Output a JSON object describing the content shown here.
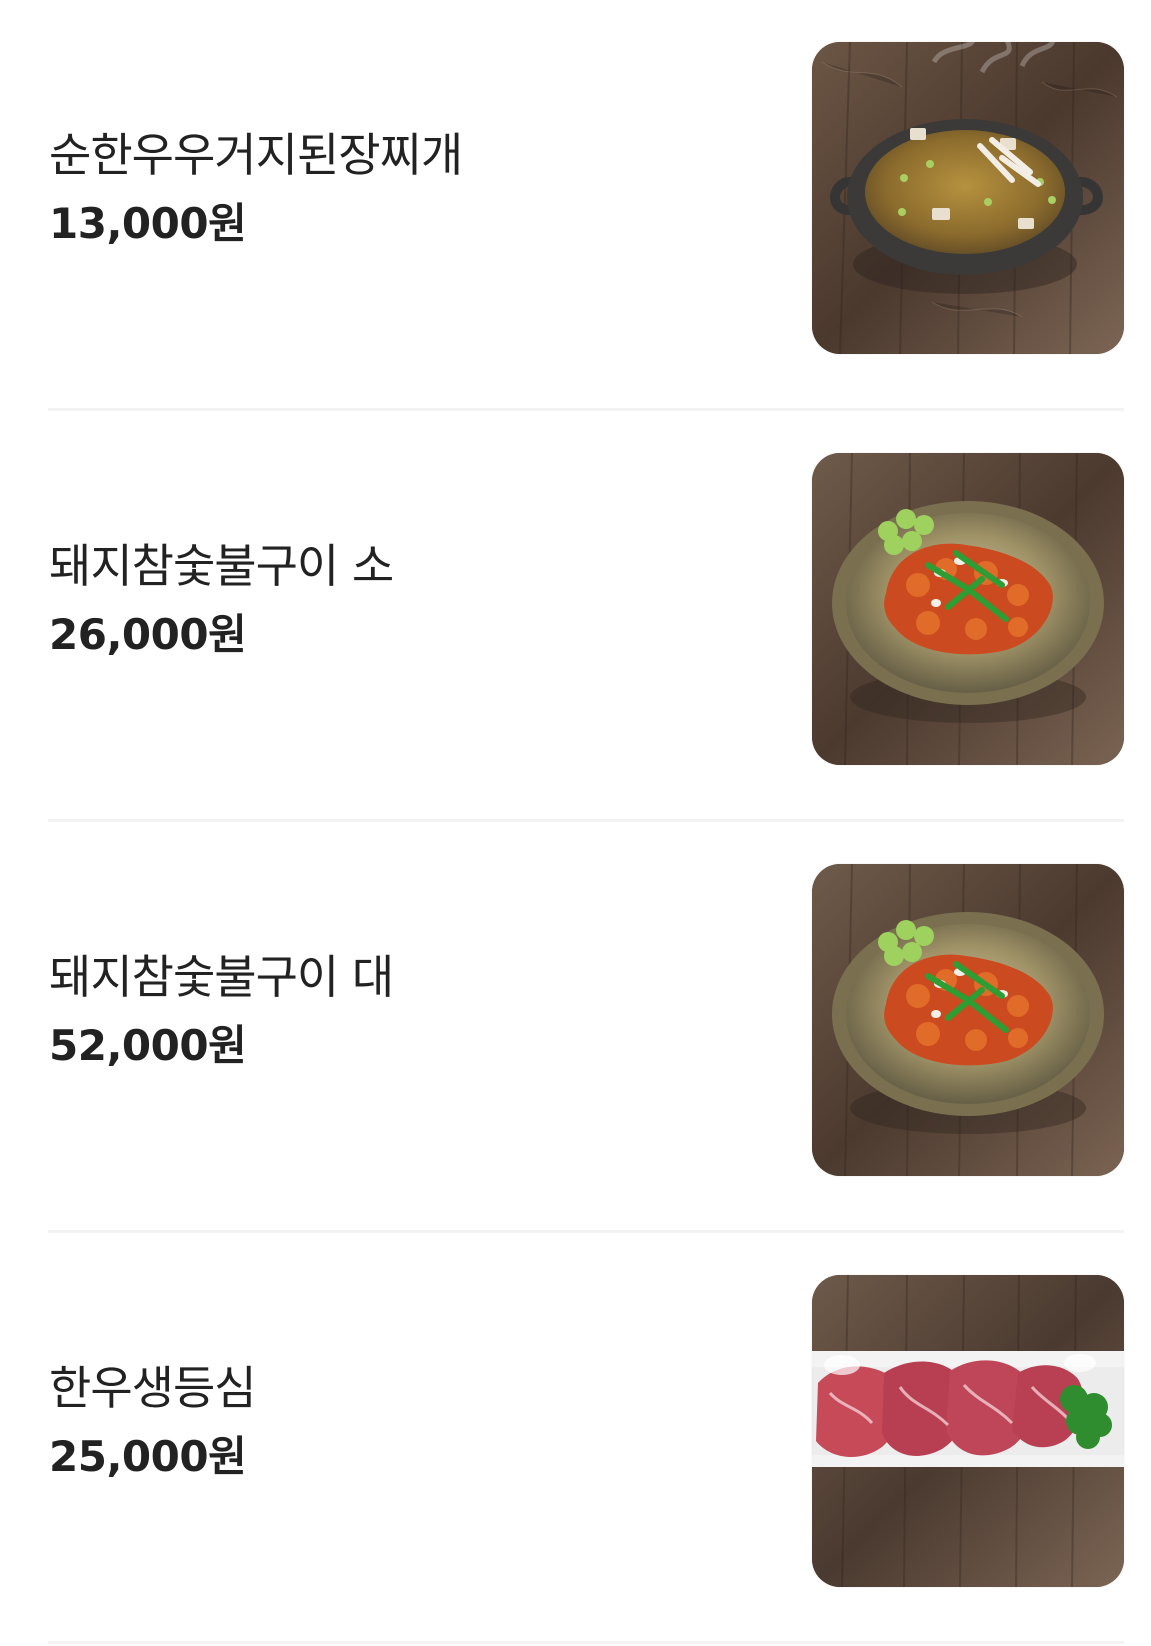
{
  "menu": {
    "items": [
      {
        "name": "순한우우거지된장찌개",
        "price": "13,000원",
        "image_icon": "stew-photo"
      },
      {
        "name": "돼지참숯불구이 소",
        "price": "26,000원",
        "image_icon": "bbq-photo"
      },
      {
        "name": "돼지참숯불구이 대",
        "price": "52,000원",
        "image_icon": "bbq-photo"
      },
      {
        "name": "한우생등심",
        "price": "25,000원",
        "image_icon": "beef-photo"
      }
    ]
  }
}
